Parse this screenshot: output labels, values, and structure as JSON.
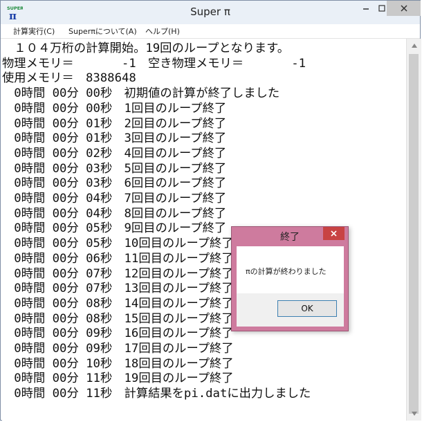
{
  "window": {
    "title": "Super π",
    "app_icon_text_top": "SUPER",
    "app_icon_glyph": "π"
  },
  "menu": {
    "items": [
      {
        "label": "計算実行(C)"
      },
      {
        "label": "Superπについて(A)"
      },
      {
        "label": "ヘルプ(H)"
      }
    ]
  },
  "console": {
    "lines": [
      "　１０４万桁の計算開始。19回のループとなります。",
      "物理メモリ＝　　　　-1　空き物理メモリ＝　　　　-1",
      "使用メモリ＝　8388648",
      "　0時間 00分 00秒　初期値の計算が終了しました",
      "　0時間 00分 00秒　1回目のループ終了",
      "　0時間 00分 01秒　2回目のループ終了",
      "　0時間 00分 01秒　3回目のループ終了",
      "　0時間 00分 02秒　4回目のループ終了",
      "　0時間 00分 03秒　5回目のループ終了",
      "　0時間 00分 03秒　6回目のループ終了",
      "　0時間 00分 04秒　7回目のループ終了",
      "　0時間 00分 04秒　8回目のループ終了",
      "　0時間 00分 05秒　9回目のループ終了",
      "　0時間 00分 05秒　10回目のループ終了",
      "　0時間 00分 06秒　11回目のループ終了",
      "　0時間 00分 07秒　12回目のループ終了",
      "　0時間 00分 07秒　13回目のループ終了",
      "　0時間 00分 08秒　14回目のループ終了",
      "　0時間 00分 08秒　15回目のループ終了",
      "　0時間 00分 09秒　16回目のループ終了",
      "　0時間 00分 09秒　17回目のループ終了",
      "　0時間 00分 10秒　18回目のループ終了",
      "　0時間 00分 11秒　19回目のループ終了",
      "　0時間 00分 11秒　計算結果をpi.datに出力しました"
    ]
  },
  "dialog": {
    "title": "終了",
    "message": "πの計算が終わりました",
    "ok_label": "OK"
  },
  "colors": {
    "dialog_frame": "#ce7b9e",
    "close_button": "#c84343"
  }
}
